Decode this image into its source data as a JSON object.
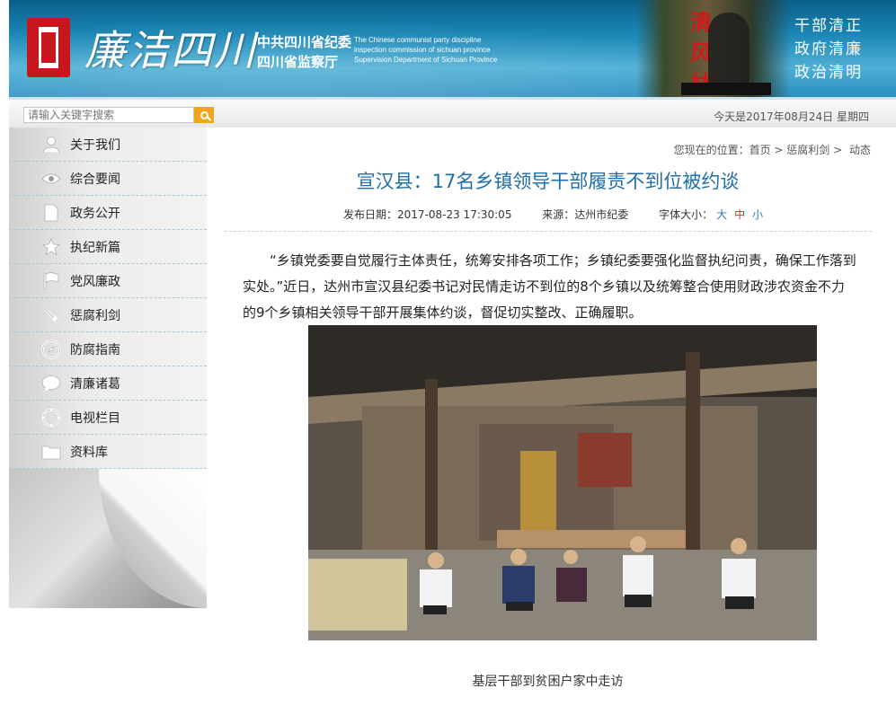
{
  "header": {
    "brand": "廉洁四川",
    "org_line1": "中共四川省纪委",
    "org_line2": "四川省监察厅",
    "org_en_line1": "The Chinese communist party discipline",
    "org_en_line2": "inspection  commission of sichuan province",
    "org_en_line3": "Supervision Department of Sichuan Province",
    "statue_text": "清风林",
    "slogans": [
      "干部清正",
      "政府清廉",
      "政治清明"
    ]
  },
  "toolbar": {
    "search_placeholder": "请输入关键字搜索",
    "date": "今天是2017年08月24日 星期四"
  },
  "sidebar": {
    "items": [
      {
        "label": "关于我们",
        "icon": "user-icon"
      },
      {
        "label": "综合要闻",
        "icon": "eye-icon"
      },
      {
        "label": "政务公开",
        "icon": "document-icon"
      },
      {
        "label": "执纪新篇",
        "icon": "star-icon"
      },
      {
        "label": "党风廉政",
        "icon": "flag-icon"
      },
      {
        "label": "惩腐利剑",
        "icon": "sword-icon"
      },
      {
        "label": "防腐指南",
        "icon": "compass-icon"
      },
      {
        "label": "清廉诸葛",
        "icon": "chat-icon"
      },
      {
        "label": "电视栏目",
        "icon": "circle-icon"
      },
      {
        "label": "资料库",
        "icon": "folder-icon"
      }
    ]
  },
  "breadcrumb": {
    "prefix": "您现在的位置：",
    "home": "首页",
    "sep1": " > ",
    "section": "惩腐利剑",
    "sep2": " > ",
    "current": "动态"
  },
  "article": {
    "title": "宣汉县：17名乡镇领导干部履责不到位被约谈",
    "publish": "发布日期：2017-08-23 17:30:05",
    "source": "来源：达州市纪委",
    "font_size_label": "字体大小：",
    "font_sizes": [
      "大",
      "中",
      "小"
    ],
    "paragraph": "“乡镇党委要自觉履行主体责任，统筹安排各项工作；乡镇纪委要强化监督执纪问责，确保工作落到实处。”近日，达州市宣汉县纪委书记对民情走访不到位的8个乡镇以及统筹整合使用财政涉农资金不力的9个乡镇相关领导干部开展集体约谈，督促切实整改、正确履职。",
    "caption": "基层干部到贫困户家中走访"
  }
}
